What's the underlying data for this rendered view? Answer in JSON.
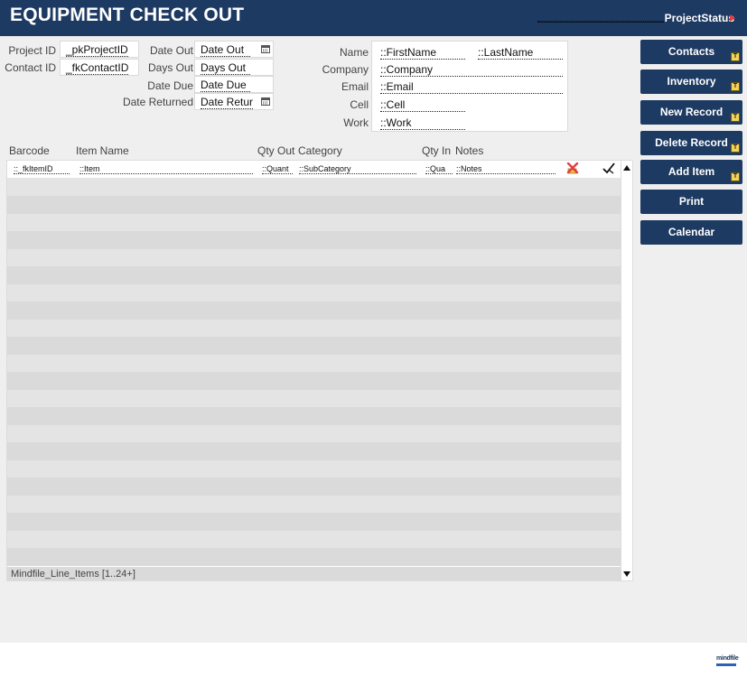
{
  "header": {
    "title": "EQUIPMENT CHECK OUT",
    "project_status": "ProjectStatus"
  },
  "ids": {
    "project_id_label": "Project ID",
    "project_id_value": "_pkProjectID",
    "contact_id_label": "Contact ID",
    "contact_id_value": "_fkContactID"
  },
  "dates": {
    "date_out_label": "Date Out",
    "date_out_value": "Date Out",
    "days_out_label": "Days Out",
    "days_out_value": "Days Out",
    "date_due_label": "Date Due",
    "date_due_value": "Date Due",
    "date_returned_label": "Date Returned",
    "date_returned_value": "Date Retur"
  },
  "contact": {
    "name_label": "Name",
    "first_name": "::FirstName",
    "last_name": "::LastName",
    "company_label": "Company",
    "company": "::Company",
    "email_label": "Email",
    "email": "::Email",
    "cell_label": "Cell",
    "cell": "::Cell",
    "work_label": "Work",
    "work": "::Work"
  },
  "columns": {
    "barcode": "Barcode",
    "item_name": "Item Name",
    "qty_out": "Qty Out",
    "category": "Category",
    "qty_in": "Qty In",
    "notes": "Notes"
  },
  "portal": {
    "first_row": {
      "barcode": "::_fkItemID",
      "item": "::Item",
      "qty_out": "::Quant",
      "category": "::SubCategory",
      "qty_in": "::Qua",
      "notes": "::Notes"
    },
    "footer": "Mindfile_Line_Items [1..24+]"
  },
  "buttons": {
    "contacts": "Contacts",
    "inventory": "Inventory",
    "new_record": "New Record",
    "delete_record": "Delete Record",
    "add_item": "Add Item",
    "print": "Print",
    "calendar": "Calendar",
    "tag_letter": "T"
  },
  "logo": {
    "text": "mindfile"
  },
  "colors": {
    "header_bg": "#1d3a62",
    "button_bg": "#1d3a62",
    "tag_bg": "#f3d35a",
    "delete_icon": "#e23d3d"
  }
}
